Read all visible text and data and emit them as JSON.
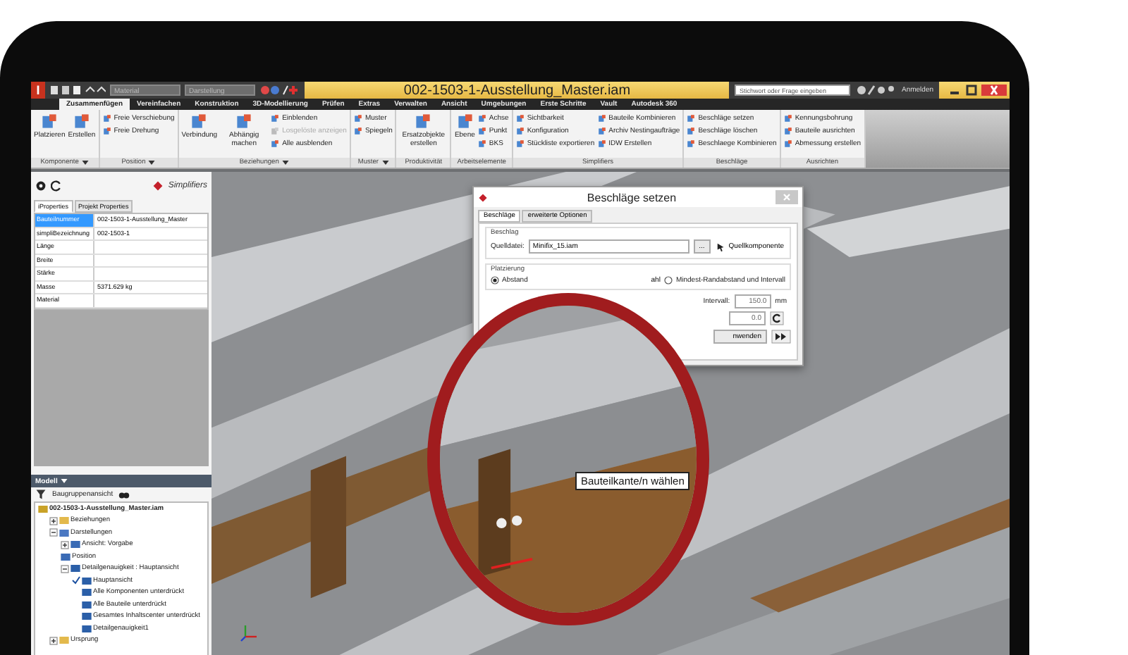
{
  "titlebar": {
    "logo": "I",
    "combos": [
      {
        "placeholder": "Material"
      },
      {
        "placeholder": "Darstellung"
      }
    ],
    "title": "002-1503-1-Ausstellung_Master.iam",
    "search": {
      "placeholder": "Stichwort oder Frage eingeben"
    },
    "signin": "Anmelden"
  },
  "tabs": [
    {
      "label": "Zusammenfügen",
      "selected": true
    },
    {
      "label": "Vereinfachen",
      "selected": false
    },
    {
      "label": "Konstruktion",
      "selected": false
    },
    {
      "label": "3D-Modellierung",
      "selected": false
    },
    {
      "label": "Prüfen",
      "selected": false
    },
    {
      "label": "Extras",
      "selected": false
    },
    {
      "label": "Verwalten",
      "selected": false
    },
    {
      "label": "Ansicht",
      "selected": false
    },
    {
      "label": "Umgebungen",
      "selected": false
    },
    {
      "label": "Erste Schritte",
      "selected": false
    },
    {
      "label": "Vault",
      "selected": false
    },
    {
      "label": "Autodesk 360",
      "selected": false
    }
  ],
  "ribbon": {
    "panels": [
      {
        "label": "Komponente",
        "menu": true,
        "items": [
          {
            "kind": "large",
            "label": "Platzieren",
            "disabled": false
          },
          {
            "kind": "large",
            "label": "Erstellen",
            "disabled": false
          }
        ]
      },
      {
        "label": "Position",
        "menu": true,
        "items": [
          {
            "kind": "small",
            "label": "Freie Verschiebung",
            "disabled": false
          },
          {
            "kind": "small",
            "label": "Freie Drehung",
            "disabled": false
          }
        ]
      },
      {
        "label": "Beziehungen",
        "menu": true,
        "items": [
          {
            "kind": "large",
            "label": "Verbindung",
            "disabled": false
          },
          {
            "kind": "large",
            "label": "Abhängig machen",
            "disabled": false
          },
          {
            "kind": "small",
            "label": "Einblenden",
            "disabled": false
          },
          {
            "kind": "small",
            "label": "Losgelöste anzeigen",
            "disabled": true
          },
          {
            "kind": "small",
            "label": "Alle ausblenden",
            "disabled": false
          }
        ]
      },
      {
        "label": "Muster",
        "menu": true,
        "items": [
          {
            "kind": "small",
            "label": "Muster",
            "disabled": false
          },
          {
            "kind": "small",
            "label": "Spiegeln",
            "disabled": false
          }
        ]
      },
      {
        "label": "Produktivität",
        "menu": false,
        "items": [
          {
            "kind": "large",
            "label": "Ersatzobjekte erstellen",
            "disabled": false
          }
        ]
      },
      {
        "label": "Arbeitselemente",
        "menu": false,
        "items": [
          {
            "kind": "large",
            "label": "Ebene",
            "disabled": false
          },
          {
            "kind": "small",
            "label": "Achse",
            "disabled": false
          },
          {
            "kind": "small",
            "label": "Punkt",
            "disabled": false
          },
          {
            "kind": "small",
            "label": "BKS",
            "disabled": false
          }
        ]
      },
      {
        "label": "Simplifiers",
        "menu": false,
        "items": [
          {
            "kind": "small",
            "label": "Sichtbarkeit",
            "disabled": false
          },
          {
            "kind": "small",
            "label": "Konfiguration",
            "disabled": false
          },
          {
            "kind": "small",
            "label": "Stückliste exportieren",
            "disabled": false
          },
          {
            "kind": "small",
            "label": "Bauteile Kombinieren",
            "disabled": false
          },
          {
            "kind": "small",
            "label": "Archiv Nestingaufträge",
            "disabled": false
          },
          {
            "kind": "small",
            "label": "IDW Erstellen",
            "disabled": false
          }
        ]
      },
      {
        "label": "Beschläge",
        "menu": false,
        "items": [
          {
            "kind": "small",
            "label": "Beschläge setzen",
            "disabled": false
          },
          {
            "kind": "small",
            "label": "Beschläge löschen",
            "disabled": false
          },
          {
            "kind": "small",
            "label": "Beschlaege Kombinieren",
            "disabled": false
          }
        ]
      },
      {
        "label": "Ausrichten",
        "menu": false,
        "items": [
          {
            "kind": "small",
            "label": "Kennungsbohrung",
            "disabled": false
          },
          {
            "kind": "small",
            "label": "Bauteile ausrichten",
            "disabled": false
          },
          {
            "kind": "small",
            "label": "Abmessung erstellen",
            "disabled": false
          }
        ]
      }
    ]
  },
  "properties": {
    "logo": "Simplifiers",
    "tabs": [
      {
        "label": "iProperties",
        "selected": true
      },
      {
        "label": "Projekt Properties",
        "selected": false
      }
    ],
    "rows": [
      {
        "name": "Bauteilnummer",
        "value": "002-1503-1-Ausstellung_Master",
        "selected": true
      },
      {
        "name": "simpliBezeichnung",
        "value": "002-1503-1",
        "selected": false
      },
      {
        "name": "Länge",
        "value": "",
        "selected": false
      },
      {
        "name": "Breite",
        "value": "",
        "selected": false
      },
      {
        "name": "Stärke",
        "value": "",
        "selected": false
      },
      {
        "name": "Masse",
        "value": "5371.629 kg",
        "selected": false
      },
      {
        "name": "Material",
        "value": "",
        "selected": false
      }
    ]
  },
  "browser": {
    "title": "Modell",
    "view": "Baugruppenansicht",
    "tree": [
      {
        "label": "002-1503-1-Ausstellung_Master.iam",
        "kind": "assembly",
        "children": [
          {
            "label": "Beziehungen",
            "kind": "folder",
            "expanded": false
          },
          {
            "label": "Darstellungen",
            "kind": "views",
            "expanded": true,
            "children": [
              {
                "label": "Ansicht: Vorgabe",
                "kind": "view",
                "expanded": false
              },
              {
                "label": "Position",
                "kind": "position"
              },
              {
                "label": "Detailgenauigkeit : Hauptansicht",
                "kind": "detail",
                "expanded": true,
                "children": [
                  {
                    "label": "Hauptansicht",
                    "kind": "detail",
                    "checked": true
                  },
                  {
                    "label": "Alle Komponenten unterdrückt",
                    "kind": "detail",
                    "checked": false
                  },
                  {
                    "label": "Alle Bauteile unterdrückt",
                    "kind": "detail",
                    "checked": false
                  },
                  {
                    "label": "Gesamtes Inhaltscenter unterdrückt",
                    "kind": "detail",
                    "checked": false
                  },
                  {
                    "label": "Detailgenauigkeit1",
                    "kind": "detail",
                    "checked": false
                  }
                ]
              }
            ]
          },
          {
            "label": "Ursprung",
            "kind": "folder",
            "expanded": false
          }
        ]
      }
    ]
  },
  "dialog": {
    "title": "Beschläge setzen",
    "tabs": [
      {
        "label": "Beschläge",
        "selected": true
      },
      {
        "label": "erweiterte Optionen",
        "selected": false
      }
    ],
    "beschlag": {
      "label": "Beschlag",
      "field_label": "Quelldatei:",
      "value": "Minifix_15.iam",
      "browse": "...",
      "pick": "Quellkomponente"
    },
    "platzierung": {
      "label": "Platzierung",
      "fragment": "ahl",
      "options": [
        {
          "label": "Abstand",
          "selected": true
        },
        {
          "label": "Mindest-Randabstand und Intervall",
          "selected": false
        }
      ]
    },
    "interval": {
      "label": "Intervall:",
      "value": "150.0",
      "unit": "mm"
    },
    "field_2": {
      "value": "0.0"
    },
    "apply": "nwenden"
  },
  "tooltip": "Bauteilkante/n wählen"
}
